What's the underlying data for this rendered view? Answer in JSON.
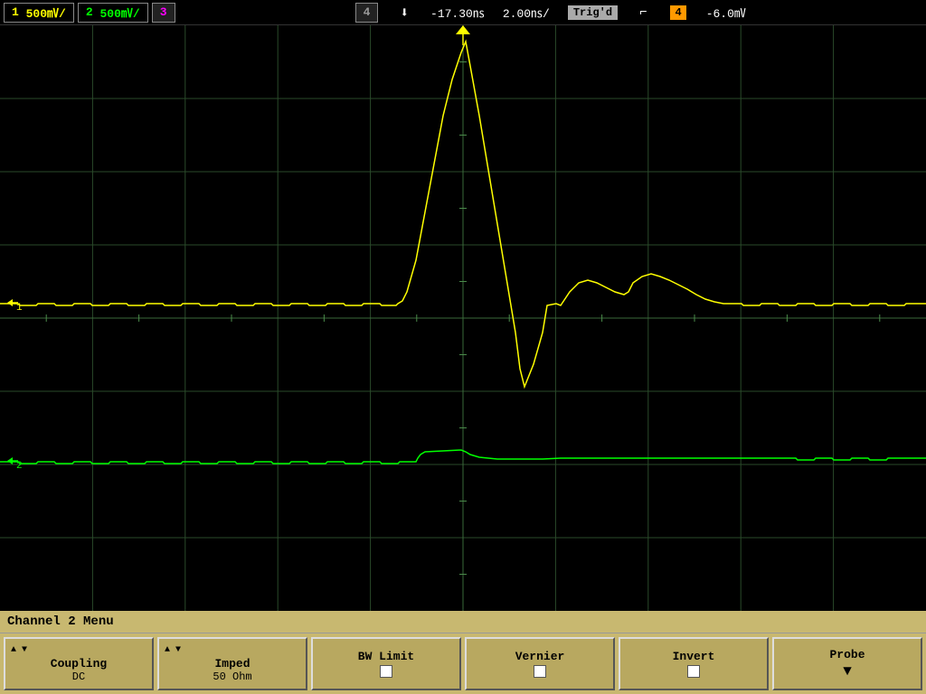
{
  "topbar": {
    "ch1_label": "1",
    "ch1_scale": "500㎷/",
    "ch2_label": "2",
    "ch2_scale": "500㎷/",
    "ch3_label": "3",
    "ch4_label": "4",
    "time_offset": "-17.30㎱",
    "time_scale": "2.00㎱/",
    "trig_status": "Trig'd",
    "trig_icon": "f",
    "trig_ch": "4",
    "volt_offset": "-6.0㎷"
  },
  "scope": {
    "grid_color": "#2a4a2a",
    "grid_divisions_h": 10,
    "grid_divisions_v": 8,
    "ch1_color": "#ffff00",
    "ch2_color": "#00ff00",
    "ch1_ground_y_pct": 46,
    "ch2_ground_y_pct": 73
  },
  "bottom_menu": {
    "title": "Channel 2  Menu",
    "buttons": [
      {
        "has_arrow": true,
        "label": "Coupling",
        "value": "DC"
      },
      {
        "has_arrow": true,
        "label": "Imped",
        "value": "50 Ohm"
      },
      {
        "has_arrow": false,
        "label": "BW Limit",
        "value": "",
        "has_checkbox": true
      },
      {
        "has_arrow": false,
        "label": "Vernier",
        "value": "",
        "has_checkbox": true
      },
      {
        "has_arrow": false,
        "label": "Invert",
        "value": "",
        "has_checkbox": true
      },
      {
        "has_arrow": false,
        "label": "Probe",
        "value": "",
        "has_down_arrow": true
      }
    ]
  }
}
